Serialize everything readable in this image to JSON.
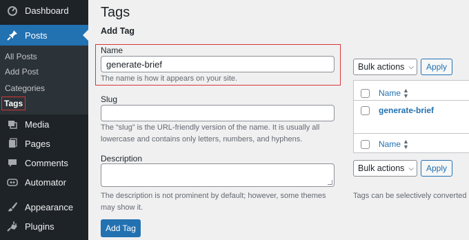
{
  "sidebar": {
    "items": [
      {
        "label": "Dashboard",
        "icon": "dashboard-icon"
      },
      {
        "label": "Posts",
        "icon": "pin-icon"
      },
      {
        "label": "Media",
        "icon": "media-icon"
      },
      {
        "label": "Pages",
        "icon": "pages-icon"
      },
      {
        "label": "Comments",
        "icon": "comment-icon"
      },
      {
        "label": "Automator",
        "icon": "automator-icon"
      },
      {
        "label": "Appearance",
        "icon": "brush-icon"
      },
      {
        "label": "Plugins",
        "icon": "plugin-icon"
      }
    ],
    "submenu": [
      "All Posts",
      "Add Post",
      "Categories",
      "Tags"
    ]
  },
  "page": {
    "title": "Tags",
    "add_tag_heading": "Add Tag"
  },
  "form": {
    "name_label": "Name",
    "name_value": "generate-brief",
    "name_help": "The name is how it appears on your site.",
    "slug_label": "Slug",
    "slug_value": "",
    "slug_help": "The “slug” is the URL-friendly version of the name. It is usually all lowercase and contains only letters, numbers, and hyphens.",
    "description_label": "Description",
    "description_help": "The description is not prominent by default; however, some themes may show it.",
    "submit_label": "Add Tag"
  },
  "list": {
    "bulk_actions_label": "Bulk actions",
    "apply_label": "Apply",
    "column_name": "Name",
    "rows": [
      "generate-brief"
    ],
    "footnote": "Tags can be selectively converted"
  },
  "colors": {
    "accent": "#2271b1",
    "sidebar_bg": "#1d2327",
    "highlight": "#d63638"
  }
}
